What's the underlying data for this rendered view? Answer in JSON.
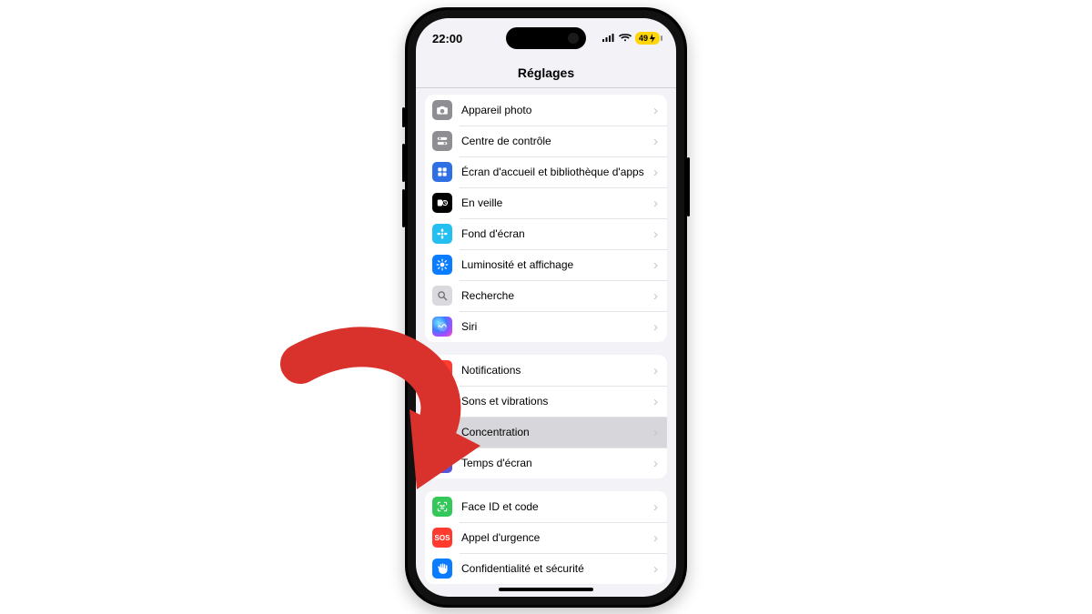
{
  "status": {
    "time": "22:00",
    "battery_text": "49"
  },
  "header": {
    "title": "Réglages"
  },
  "groups": [
    {
      "id": "display",
      "items": [
        {
          "id": "camera",
          "label": "Appareil photo",
          "icon": "camera",
          "color": "#8e8e93"
        },
        {
          "id": "controlcenter",
          "label": "Centre de contrôle",
          "icon": "toggles",
          "color": "#8e8e93"
        },
        {
          "id": "homescreen",
          "label": "Écran d'accueil et bibliothèque d'apps",
          "icon": "apps",
          "color": "#2f6fe4"
        },
        {
          "id": "standby",
          "label": "En veille",
          "icon": "standby",
          "color": "#000000"
        },
        {
          "id": "wallpaper",
          "label": "Fond d'écran",
          "icon": "flower",
          "color": "#22bff0"
        },
        {
          "id": "brightness",
          "label": "Luminosité et affichage",
          "icon": "sun",
          "color": "#0a7cff"
        },
        {
          "id": "search",
          "label": "Recherche",
          "icon": "search",
          "color": "#d9d9de"
        },
        {
          "id": "siri",
          "label": "Siri",
          "icon": "siri",
          "color": "siri"
        }
      ]
    },
    {
      "id": "attention",
      "items": [
        {
          "id": "notifications",
          "label": "Notifications",
          "icon": "bell",
          "color": "#ff3b30"
        },
        {
          "id": "sounds",
          "label": "Sons et vibrations",
          "icon": "speaker",
          "color": "#ff375f"
        },
        {
          "id": "focus",
          "label": "Concentration",
          "icon": "moon",
          "color": "#5856d6",
          "highlight": true
        },
        {
          "id": "screentime",
          "label": "Temps d'écran",
          "icon": "hourglass",
          "color": "#5856d6"
        }
      ]
    },
    {
      "id": "security",
      "items": [
        {
          "id": "faceid",
          "label": "Face ID et code",
          "icon": "faceid",
          "color": "#34c759"
        },
        {
          "id": "sos",
          "label": "Appel d'urgence",
          "icon": "sos",
          "color": "#ff3b30"
        },
        {
          "id": "privacy",
          "label": "Confidentialité et sécurité",
          "icon": "hand",
          "color": "#0a7cff"
        }
      ]
    }
  ],
  "annotation": {
    "target": "focus"
  }
}
